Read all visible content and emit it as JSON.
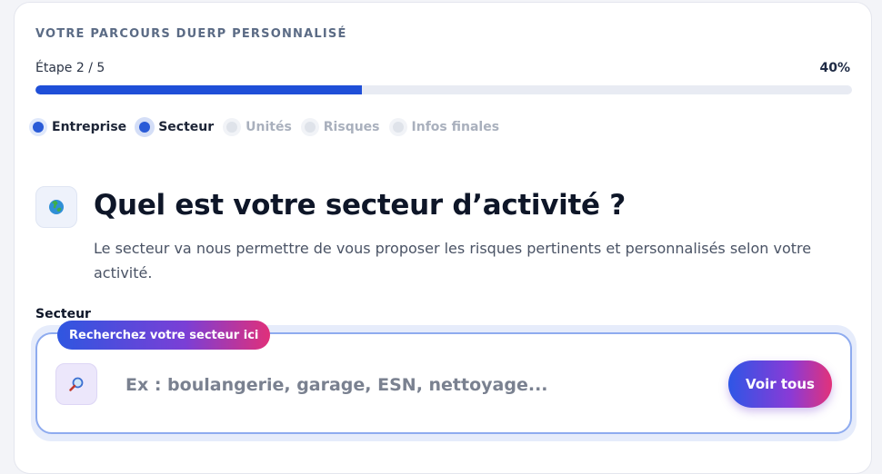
{
  "header": {
    "kicker": "VOTRE PARCOURS DUERP PERSONNALISÉ",
    "step_label": "Étape 2 / 5",
    "percent_label": "40%",
    "progress": 0.4
  },
  "steps": [
    {
      "label": "Entreprise",
      "state": "done"
    },
    {
      "label": "Secteur",
      "state": "current"
    },
    {
      "label": "Unités",
      "state": "todo"
    },
    {
      "label": "Risques",
      "state": "todo"
    },
    {
      "label": "Infos finales",
      "state": "todo"
    }
  ],
  "question": {
    "icon": "globe-icon",
    "title": "Quel est votre secteur d’activité ?",
    "description": "Le secteur va nous permettre de vous proposer les risques pertinents et personnalisés selon votre activité."
  },
  "search": {
    "field_label": "Secteur",
    "badge": "Recherchez votre secteur ici",
    "icon": "magnifier-icon",
    "value": "",
    "placeholder": "Ex : boulangerie, garage, ESN, nettoyage...",
    "button_label": "Voir tous"
  },
  "colors": {
    "accent": "#1f4fd8",
    "gradient_start": "#2f56e0",
    "gradient_mid": "#7a3fd6",
    "gradient_end": "#e0307a"
  }
}
